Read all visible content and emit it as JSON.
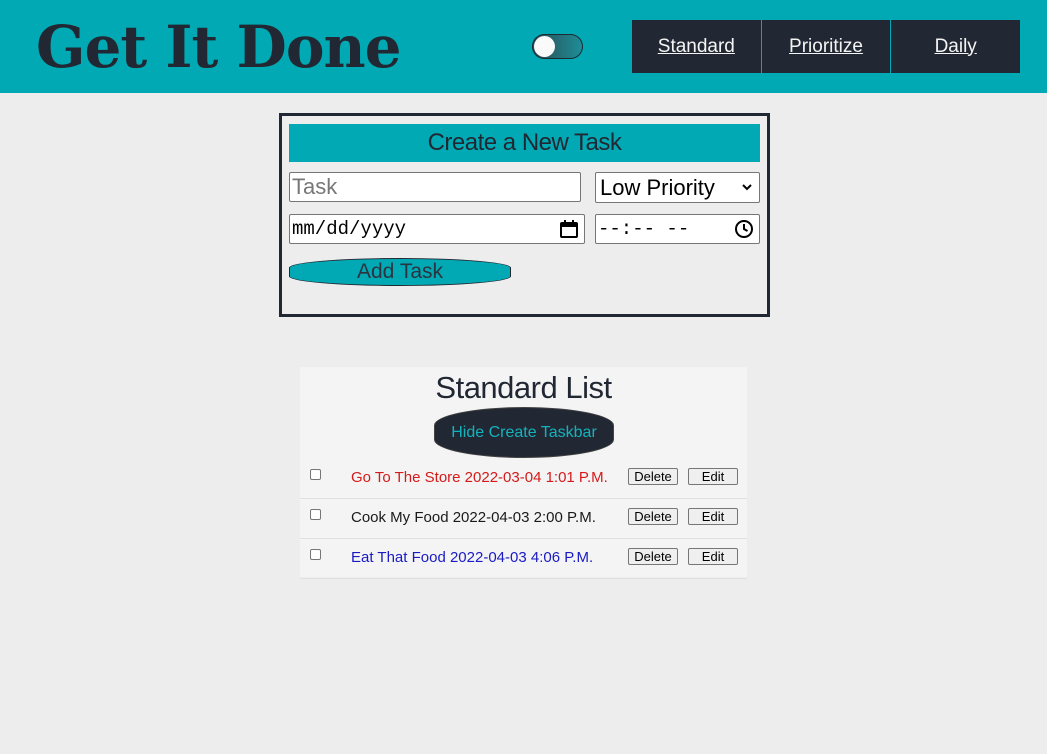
{
  "header": {
    "title": "Get It Done",
    "theme_toggle": {
      "state": "off"
    },
    "nav": [
      {
        "label": "Standard"
      },
      {
        "label": "Prioritize"
      },
      {
        "label": "Daily"
      }
    ]
  },
  "create_form": {
    "title": "Create a New Task",
    "task_placeholder": "Task",
    "task_value": "",
    "priority_selected": "Low Priority",
    "date_placeholder": "mm/dd/yyyy",
    "time_placeholder": "--:-- --",
    "add_button_label": "Add Task"
  },
  "list": {
    "title": "Standard List",
    "hide_button_label": "Hide Create Taskbar",
    "delete_label": "Delete",
    "edit_label": "Edit",
    "tasks": [
      {
        "text": "Go To The Store 2022-03-04 1:01 P.M.",
        "checked": false,
        "color": "#d41a1a"
      },
      {
        "text": "Cook My Food 2022-04-03 2:00 P.M.",
        "checked": false,
        "color": "#1a1a1a"
      },
      {
        "text": "Eat That Food 2022-04-03 4:06 P.M.",
        "checked": false,
        "color": "#1a1ac4"
      }
    ]
  },
  "colors": {
    "accent": "#00a9b3",
    "dark": "#222833",
    "background": "#ededed"
  }
}
